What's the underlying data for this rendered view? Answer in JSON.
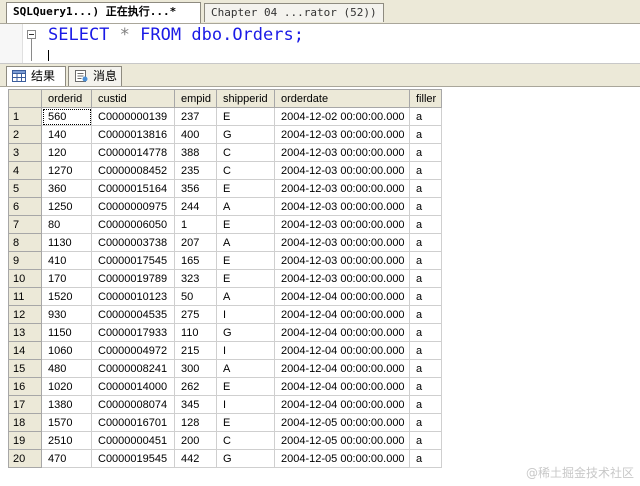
{
  "tabs": {
    "active_label": "SQLQuery1...) 正在执行...*",
    "inactive_label": "Chapter 04 ...rator (52))"
  },
  "editor": {
    "keyword_select": "SELECT",
    "star": "*",
    "keyword_from": "FROM",
    "table": "dbo.Orders;"
  },
  "result_tabs": {
    "results_label": "结果",
    "messages_label": "消息"
  },
  "grid": {
    "columns": [
      "orderid",
      "custid",
      "empid",
      "shipperid",
      "orderdate",
      "filler"
    ],
    "rows": [
      [
        "1",
        "560",
        "C0000000139",
        "237",
        "E",
        "2004-12-02 00:00:00.000",
        "a"
      ],
      [
        "2",
        "140",
        "C0000013816",
        "400",
        "G",
        "2004-12-03 00:00:00.000",
        "a"
      ],
      [
        "3",
        "120",
        "C0000014778",
        "388",
        "C",
        "2004-12-03 00:00:00.000",
        "a"
      ],
      [
        "4",
        "1270",
        "C0000008452",
        "235",
        "C",
        "2004-12-03 00:00:00.000",
        "a"
      ],
      [
        "5",
        "360",
        "C0000015164",
        "356",
        "E",
        "2004-12-03 00:00:00.000",
        "a"
      ],
      [
        "6",
        "1250",
        "C0000000975",
        "244",
        "A",
        "2004-12-03 00:00:00.000",
        "a"
      ],
      [
        "7",
        "80",
        "C0000006050",
        "1",
        "E",
        "2004-12-03 00:00:00.000",
        "a"
      ],
      [
        "8",
        "1130",
        "C0000003738",
        "207",
        "A",
        "2004-12-03 00:00:00.000",
        "a"
      ],
      [
        "9",
        "410",
        "C0000017545",
        "165",
        "E",
        "2004-12-03 00:00:00.000",
        "a"
      ],
      [
        "10",
        "170",
        "C0000019789",
        "323",
        "E",
        "2004-12-03 00:00:00.000",
        "a"
      ],
      [
        "11",
        "1520",
        "C0000010123",
        "50",
        "A",
        "2004-12-04 00:00:00.000",
        "a"
      ],
      [
        "12",
        "930",
        "C0000004535",
        "275",
        "I",
        "2004-12-04 00:00:00.000",
        "a"
      ],
      [
        "13",
        "1150",
        "C0000017933",
        "110",
        "G",
        "2004-12-04 00:00:00.000",
        "a"
      ],
      [
        "14",
        "1060",
        "C0000004972",
        "215",
        "I",
        "2004-12-04 00:00:00.000",
        "a"
      ],
      [
        "15",
        "480",
        "C0000008241",
        "300",
        "A",
        "2004-12-04 00:00:00.000",
        "a"
      ],
      [
        "16",
        "1020",
        "C0000014000",
        "262",
        "E",
        "2004-12-04 00:00:00.000",
        "a"
      ],
      [
        "17",
        "1380",
        "C0000008074",
        "345",
        "I",
        "2004-12-04 00:00:00.000",
        "a"
      ],
      [
        "18",
        "1570",
        "C0000016701",
        "128",
        "E",
        "2004-12-05 00:00:00.000",
        "a"
      ],
      [
        "19",
        "2510",
        "C0000000451",
        "200",
        "C",
        "2004-12-05 00:00:00.000",
        "a"
      ],
      [
        "20",
        "470",
        "C0000019545",
        "442",
        "G",
        "2004-12-05 00:00:00.000",
        "a"
      ]
    ]
  },
  "watermark": "@稀土掘金技术社区",
  "icons": {
    "results": "grid-icon",
    "messages": "messages-icon",
    "outline": "collapse-icon"
  }
}
